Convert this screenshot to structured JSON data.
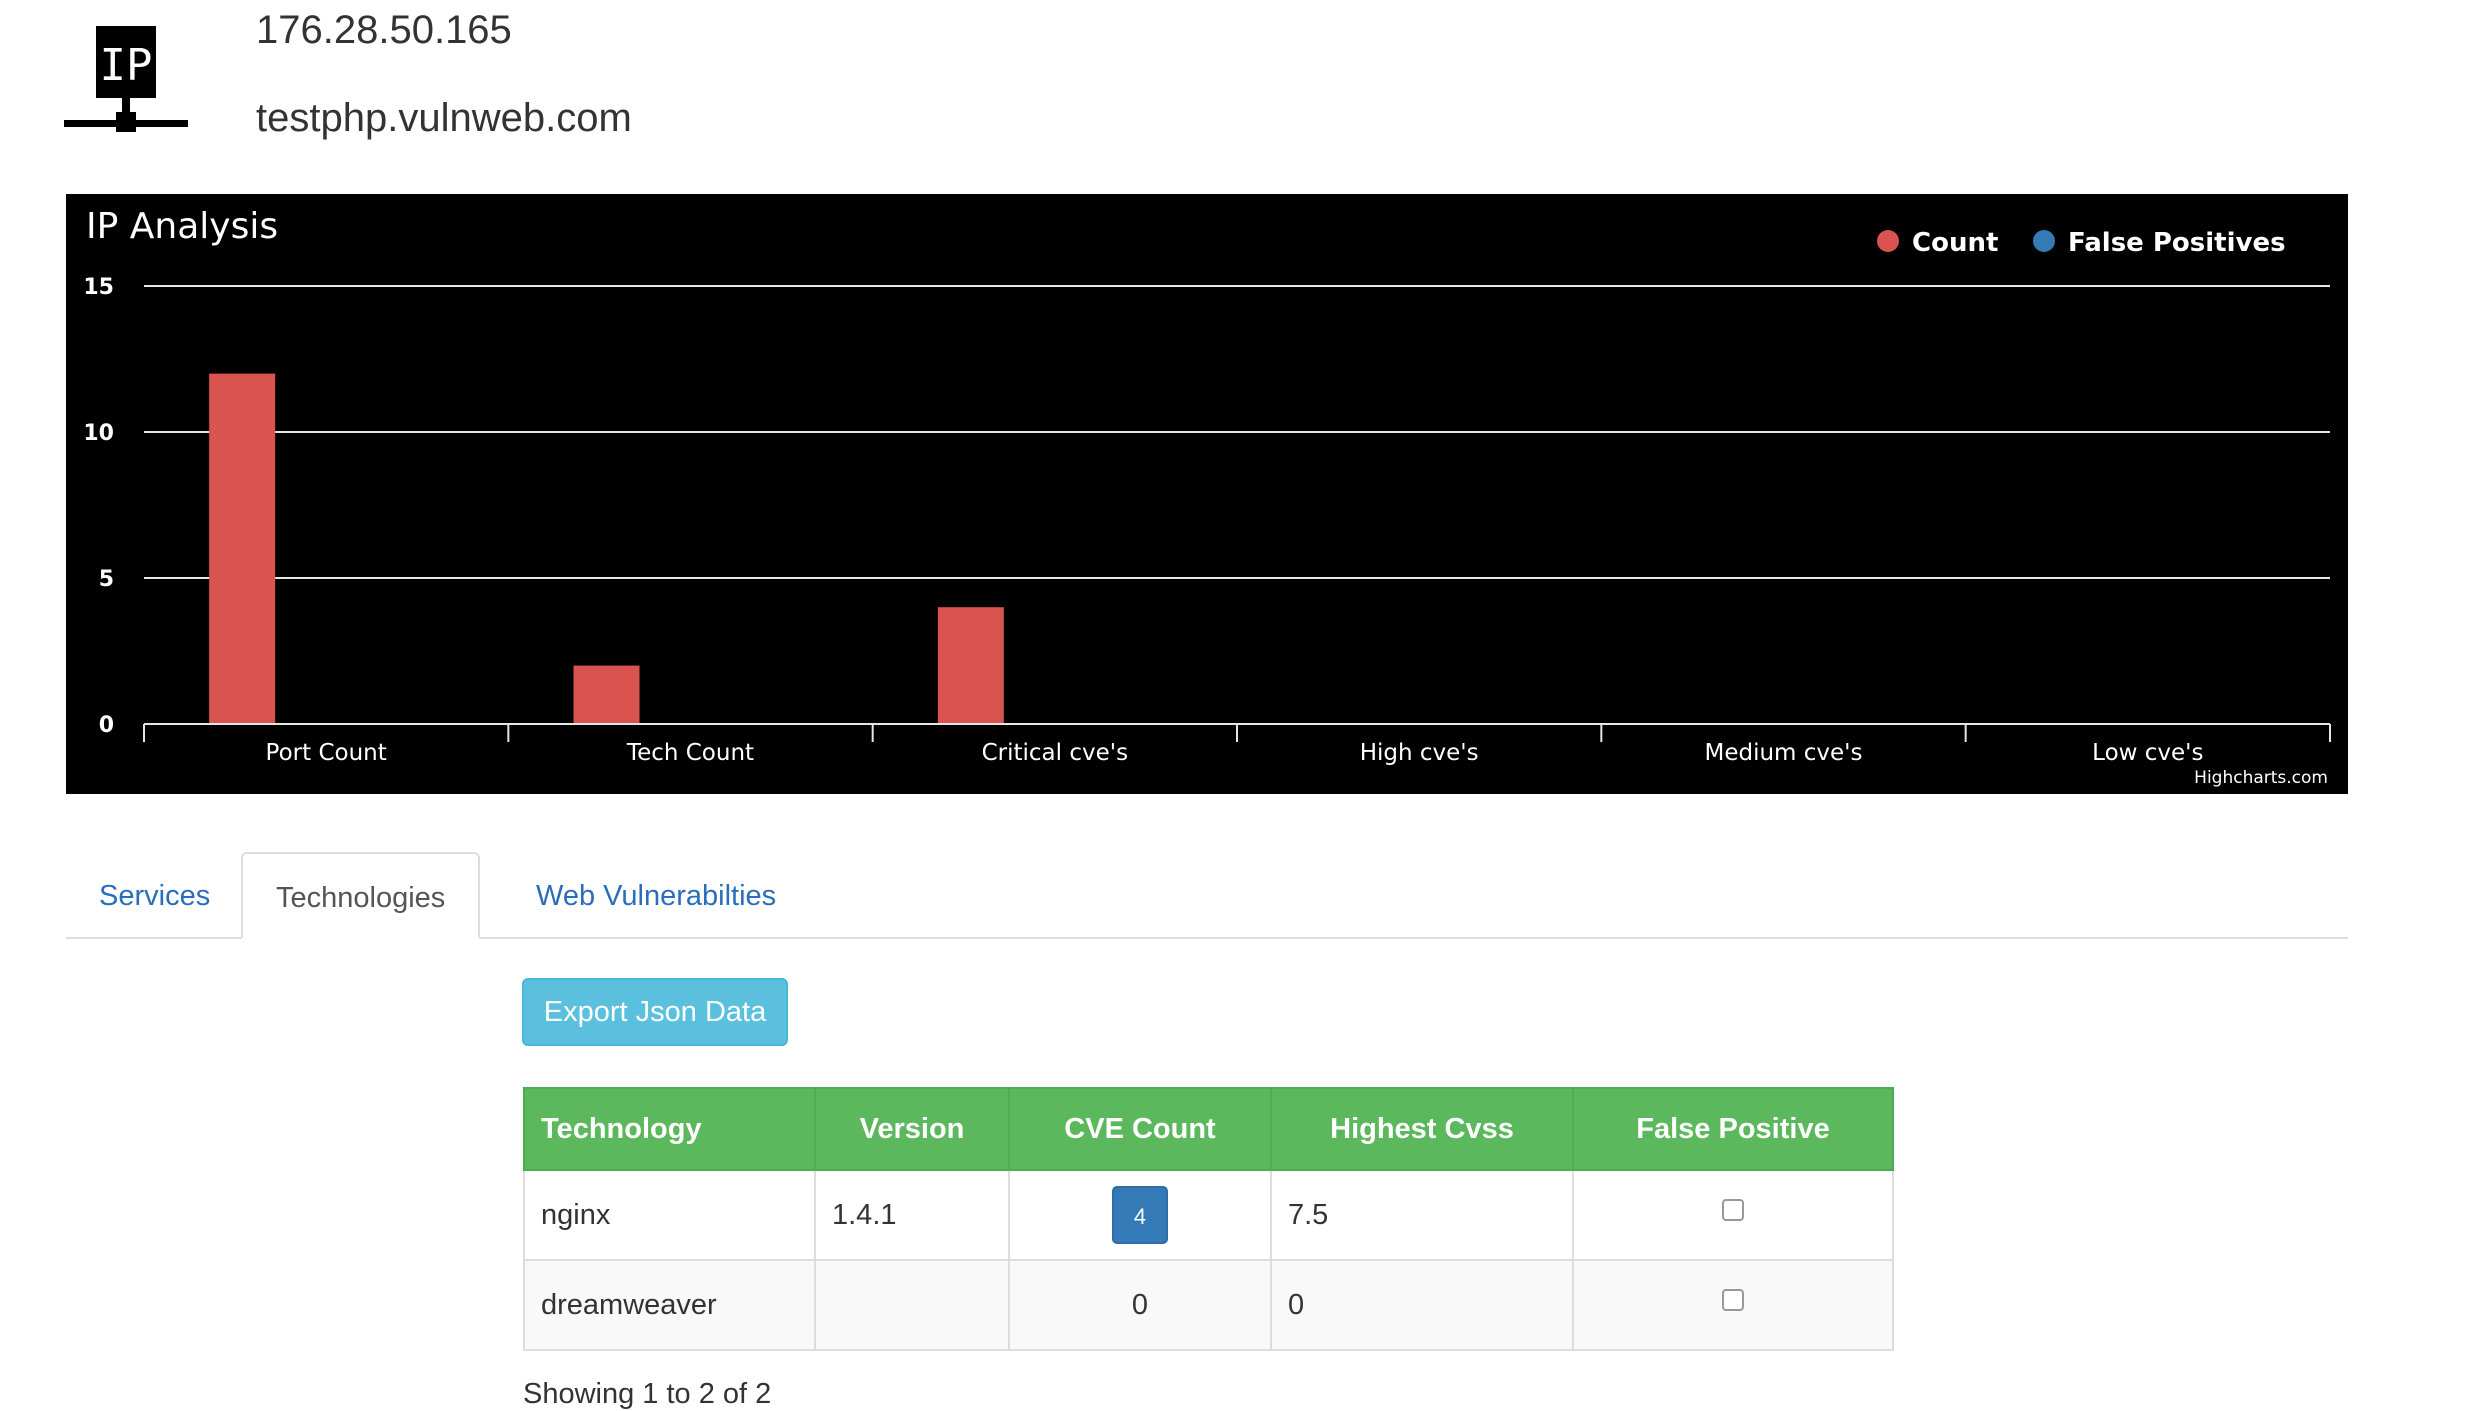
{
  "header": {
    "logo_icon": "ip-network-icon",
    "logo_text": "IP",
    "ip_address": "176.28.50.165",
    "hostname": "testphp.vulnweb.com"
  },
  "chart": {
    "background": "#000000",
    "credit": "Highcharts.com"
  },
  "chart_data": {
    "type": "bar",
    "title": "IP Analysis",
    "categories": [
      "Port Count",
      "Tech Count",
      "Critical cve's",
      "High cve's",
      "Medium cve's",
      "Low cve's"
    ],
    "series": [
      {
        "name": "Count",
        "color": "#d9534f",
        "values": [
          12,
          2,
          4,
          0,
          0,
          0
        ]
      },
      {
        "name": "False Positives",
        "color": "#337ab7",
        "values": [
          0,
          0,
          0,
          0,
          0,
          0
        ]
      }
    ],
    "yticks": [
      "0",
      "5",
      "10",
      "15"
    ],
    "ylim": [
      0,
      15
    ],
    "grid": true,
    "legend": "top-right"
  },
  "tabs": [
    {
      "label": "Services",
      "active": false
    },
    {
      "label": "Technologies",
      "active": true
    },
    {
      "label": "Web Vulnerabilties",
      "active": false
    }
  ],
  "export_button": {
    "label": "Export Json Data",
    "color": "#5bc0de"
  },
  "table": {
    "header_color": "#5cb85c",
    "columns": [
      "Technology",
      "Version",
      "CVE Count",
      "Highest Cvss",
      "False Positive"
    ],
    "rows": [
      {
        "technology": "nginx",
        "version": "1.4.1",
        "cve_count": "4",
        "highest_cvss": "7.5",
        "false_positive": false
      },
      {
        "technology": "dreamweaver",
        "version": "",
        "cve_count": "0",
        "highest_cvss": "0",
        "false_positive": false
      }
    ]
  },
  "footer": {
    "text": "Showing 1 to 2 of 2"
  }
}
